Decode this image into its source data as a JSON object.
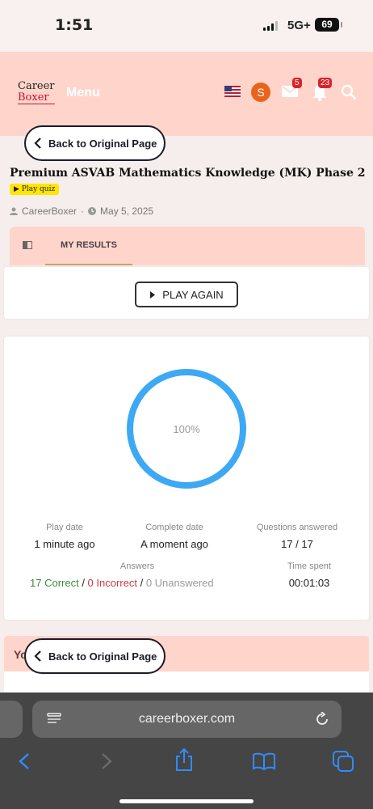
{
  "status_bar": {
    "time": "1:51",
    "network": "5G+",
    "battery": "69"
  },
  "header": {
    "logo_top": "Career",
    "logo_bottom": "Boxer",
    "menu_label": "Menu",
    "avatar_letter": "S",
    "mail_badge": "5",
    "notification_badge": "23"
  },
  "back_button_label": "Back to Original Page",
  "quiz": {
    "title": "Premium ASVAB Mathematics Knowledge (MK) Phase 2",
    "tag": "Play quiz",
    "author": "CareerBoxer",
    "date": "May 5, 2025"
  },
  "tabs": {
    "results_label": "MY RESULTS"
  },
  "actions": {
    "play_again_label": "PLAY AGAIN"
  },
  "results": {
    "score_text": "100%",
    "score_fraction": 1.0,
    "play_date_label": "Play date",
    "play_date_value": "1 minute ago",
    "complete_date_label": "Complete date",
    "complete_date_value": "A moment ago",
    "questions_label": "Questions answered",
    "questions_value": "17 / 17",
    "answers_label": "Answers",
    "correct_text": "17 Correct",
    "incorrect_text": "0 Incorrect",
    "unanswered_text": "0 Unanswered",
    "separator": " / ",
    "time_spent_label": "Time spent",
    "time_spent_value": "00:01:03"
  },
  "next_section_partial": "Yo",
  "browser": {
    "url": "careerboxer.com"
  },
  "colors": {
    "header_bg": "#ffd5cb",
    "ring": "#3da9f4",
    "correct": "#3a8a3a",
    "incorrect": "#d2393e",
    "unanswered": "#9a9a9a",
    "avatar": "#e8641b"
  }
}
